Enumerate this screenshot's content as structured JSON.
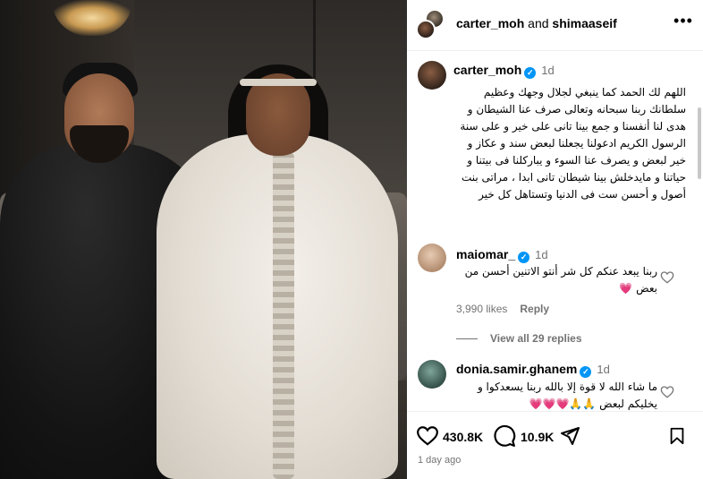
{
  "header": {
    "user1": "carter_moh",
    "joiner": " and ",
    "user2": "shimaaseif",
    "more": "•••"
  },
  "caption": {
    "username": "carter_moh",
    "time": "1d",
    "text": "اللهم لك الحمد كما ينبغي لجلال وجهك وعظيم سلطانك ربنا سبحانه وتعالى صرف عنا الشيطان و هدى لنا أنفسنا  و جمع بينا تانى على خير و على سنة الرسول الكريم ادعولنا يجعلنا لبعض سند و عكاز و خير لبعض و يصرف عنا السوء و يباركلنا فى بيتنا و حياتنا و مايدخلش بينا شيطان تانى ابدا ، مراتى بنت أصول و أحسن ست فى الدنيا وتستاهل كل خير"
  },
  "comments": [
    {
      "username": "maiomar_",
      "time": "1d",
      "text": "ربنا يبعد عنكم كل شر أنتو الاتنين أحسن من بعض 💗",
      "likes": "3,990 likes",
      "reply": "Reply"
    },
    {
      "view_all": "View all 29 replies"
    },
    {
      "username": "donia.samir.ghanem",
      "time": "1d",
      "text": "ما شاء الله لا قوة إلا بالله ربنا يسعدكوا و يخليكم لبعض 🙏🙏💗💗💗"
    }
  ],
  "actions": {
    "likes": "430.8K",
    "comments": "10.9K"
  },
  "timestamp": "1 day ago",
  "colors": {
    "verified": "#0095f6",
    "muted": "#737373",
    "divider": "#efefef"
  }
}
